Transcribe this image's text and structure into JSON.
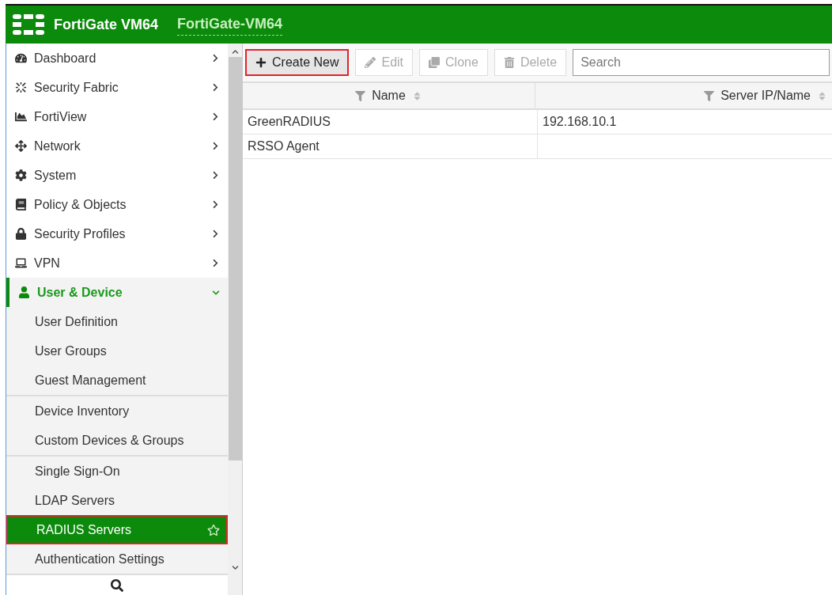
{
  "header": {
    "product": "FortiGate VM64",
    "hostname": "FortiGate-VM64"
  },
  "sidebar": {
    "items": [
      {
        "label": "Dashboard",
        "expanded": false
      },
      {
        "label": "Security Fabric",
        "expanded": false
      },
      {
        "label": "FortiView",
        "expanded": false
      },
      {
        "label": "Network",
        "expanded": false
      },
      {
        "label": "System",
        "expanded": false
      },
      {
        "label": "Policy & Objects",
        "expanded": false
      },
      {
        "label": "Security Profiles",
        "expanded": false
      },
      {
        "label": "VPN",
        "expanded": false
      },
      {
        "label": "User & Device",
        "expanded": true,
        "sections": [
          {
            "children": [
              {
                "label": "User Definition",
                "selected": false
              },
              {
                "label": "User Groups",
                "selected": false
              },
              {
                "label": "Guest Management",
                "selected": false
              }
            ]
          },
          {
            "children": [
              {
                "label": "Device Inventory",
                "selected": false
              },
              {
                "label": "Custom Devices & Groups",
                "selected": false
              }
            ]
          },
          {
            "children": [
              {
                "label": "Single Sign-On",
                "selected": false
              },
              {
                "label": "LDAP Servers",
                "selected": false
              },
              {
                "label": "RADIUS Servers",
                "selected": true,
                "highlighted": true
              },
              {
                "label": "Authentication Settings",
                "selected": false
              }
            ]
          }
        ]
      }
    ]
  },
  "toolbar": {
    "buttons": [
      {
        "label": "Create New",
        "disabled": false,
        "highlighted": true
      },
      {
        "label": "Edit",
        "disabled": true,
        "highlighted": false
      },
      {
        "label": "Clone",
        "disabled": true,
        "highlighted": false
      },
      {
        "label": "Delete",
        "disabled": true,
        "highlighted": false
      }
    ],
    "search": {
      "placeholder": "Search"
    }
  },
  "table": {
    "columns": [
      "Name",
      "Server IP/Name"
    ],
    "rows": [
      [
        "GreenRADIUS",
        "192.168.10.1"
      ],
      [
        "RSSO Agent",
        ""
      ]
    ]
  }
}
